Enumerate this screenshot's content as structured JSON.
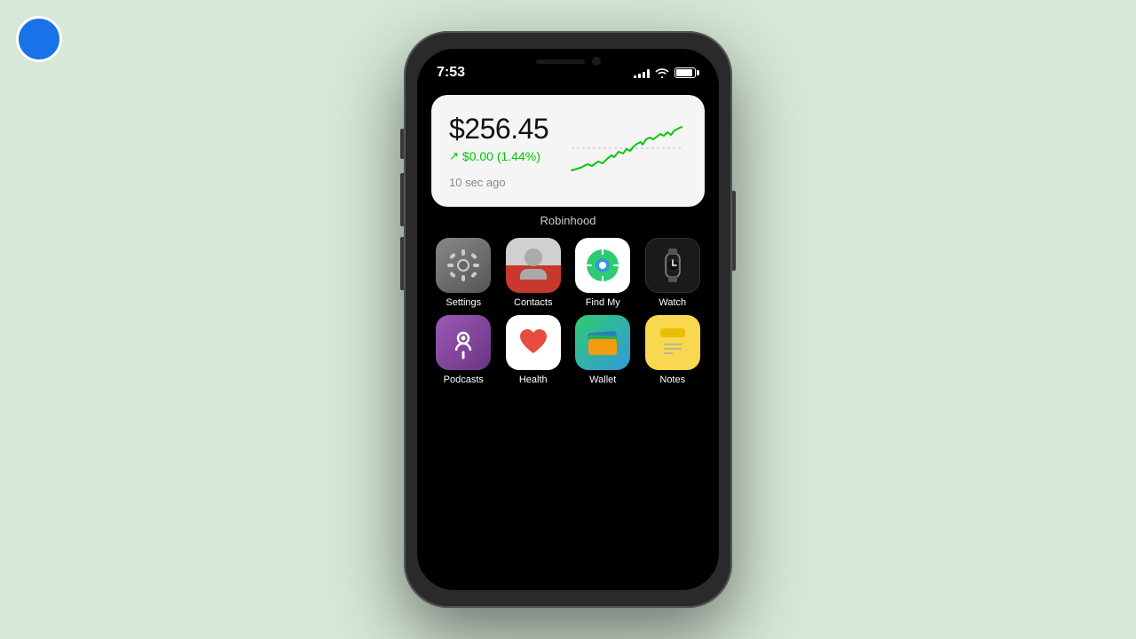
{
  "background_color": "#d6e8d8",
  "top_button": {
    "label": "screen-record"
  },
  "status_bar": {
    "time": "7:53",
    "signal_bars": [
      3,
      5,
      7,
      10,
      12
    ],
    "wifi": "wifi",
    "battery_percent": 90
  },
  "robinhood_widget": {
    "price": "$256.45",
    "change": "$0.00 (1.44%)",
    "change_arrow": "↗",
    "timestamp": "10 sec ago",
    "label": "Robinhood"
  },
  "apps_row1": [
    {
      "name": "Settings",
      "icon_type": "settings"
    },
    {
      "name": "Contacts",
      "icon_type": "contacts"
    },
    {
      "name": "Find My",
      "icon_type": "findmy"
    },
    {
      "name": "Watch",
      "icon_type": "watch"
    }
  ],
  "apps_row2": [
    {
      "name": "Podcasts",
      "icon_type": "podcast"
    },
    {
      "name": "Health",
      "icon_type": "health"
    },
    {
      "name": "Wallet",
      "icon_type": "wallet"
    },
    {
      "name": "Notes",
      "icon_type": "notes"
    }
  ]
}
